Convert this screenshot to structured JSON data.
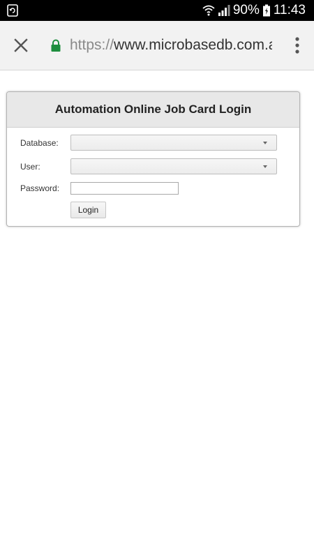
{
  "status_bar": {
    "battery_percent": "90%",
    "time": "11:43",
    "icons": [
      "screenshot-notification-icon",
      "wifi-icon",
      "signal-icon",
      "battery-icon"
    ]
  },
  "browser": {
    "url_scheme": "https://",
    "url_host": "www.microbasedb.com.a",
    "icons": [
      "close-icon",
      "lock-icon",
      "overflow-menu-icon"
    ],
    "colors": {
      "lock": "#1e8e3e",
      "toolbar_bg": "#f2f2f2"
    }
  },
  "login_form": {
    "title": "Automation Online Job Card Login",
    "database_label": "Database:",
    "database_value": "",
    "user_label": "User:",
    "user_value": "",
    "password_label": "Password:",
    "password_value": "",
    "login_button": "Login"
  }
}
